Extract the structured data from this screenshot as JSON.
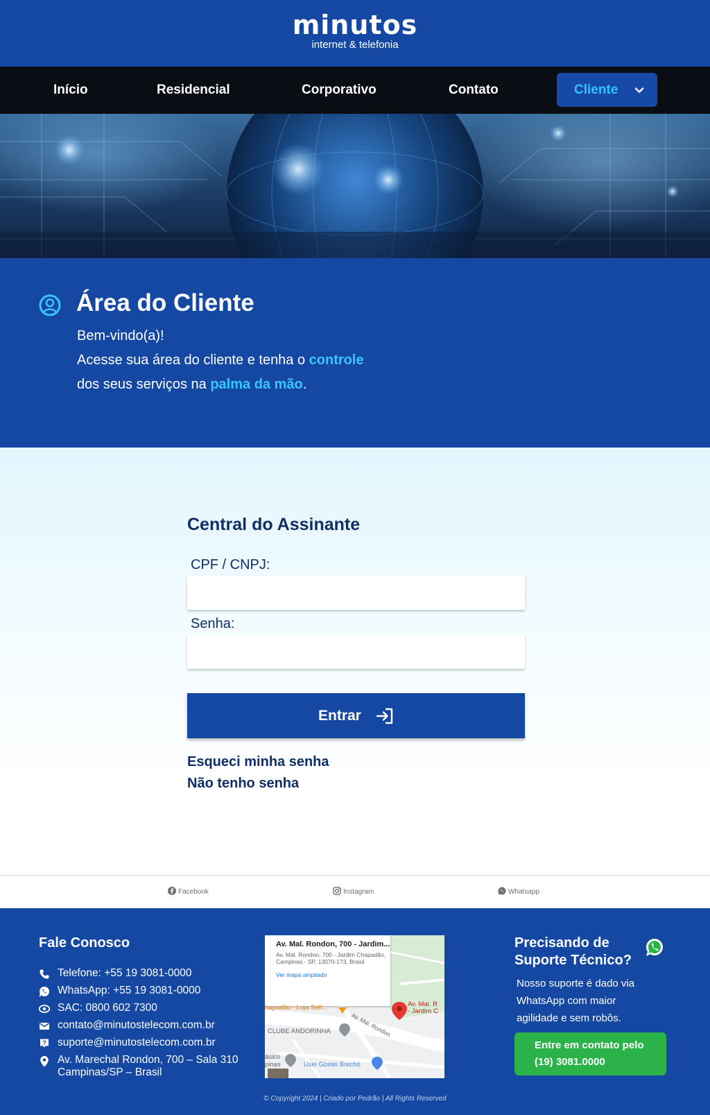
{
  "header": {
    "logo_word": "minutos",
    "logo_tagline": "internet & telefonia"
  },
  "nav": {
    "items": [
      {
        "label": "Início"
      },
      {
        "label": "Residencial"
      },
      {
        "label": "Corporativo"
      },
      {
        "label": "Contato"
      }
    ],
    "cliente_label": "Cliente"
  },
  "area": {
    "title": "Área do Cliente",
    "line1": "Bem-vindo(a)!",
    "line2_prefix": "Acesse sua área do cliente e tenha o ",
    "line2_highlight": "controle",
    "line3_prefix": "dos seus serviços na ",
    "line3_highlight": "palma da mão",
    "line3_suffix": "."
  },
  "login": {
    "title": "Central do Assinante",
    "cpf_label": "CPF / CNPJ:",
    "cpf_value": "",
    "senha_label": "Senha:",
    "senha_value": "",
    "submit_label": "Entrar",
    "forgot_link": "Esqueci minha senha",
    "no_password_link": "Não tenho senha"
  },
  "social": {
    "facebook": "Facebook",
    "instagram": "Instagram",
    "whatsapp": "Whatsapp"
  },
  "footer": {
    "contact_title": "Fale Conosco",
    "contacts": [
      {
        "icon": "phone-icon",
        "text": "Telefone: +55 19 3081-0000"
      },
      {
        "icon": "whatsapp-icon",
        "text": "WhatsApp: +55 19 3081-0000"
      },
      {
        "icon": "sac-icon",
        "text": "SAC: 0800 602 7300"
      },
      {
        "icon": "email-icon",
        "text": "contato@minutostelecom.com.br"
      },
      {
        "icon": "support-icon",
        "text": "suporte@minutostelecom.com.br"
      },
      {
        "icon": "location-pin-icon",
        "text": "Av. Marechal Rondon, 700 – Sala 310",
        "text2": "Campinas/SP – Brasil"
      }
    ],
    "map": {
      "card_title": "Av. Mal. Rondon, 700 - Jardim...",
      "card_address": "Av. Mal. Rondon, 700 - Jardim Chapadão, Campinas - SP, 13070-173, Brasil",
      "card_link": "Ver mapa ampliado",
      "label_loja": "hapadão - Loja Self...",
      "label_street": "Av. Mal. Rondon",
      "label_pin_1": "Av. Mal. R",
      "label_pin_2": "- Jardim C",
      "label_clube": "CLUBE ANDORINHA",
      "label_asico_1": "ásico",
      "label_asico_2": "pinas",
      "label_usei": "Usei Gostei Brechó"
    },
    "support_title_1": "Precisando de",
    "support_title_2": "Suporte Técnico?",
    "support_text_1": "Nosso suporte é dado via",
    "support_text_2": "WhatsApp com maior",
    "support_text_3": "agilidade e sem robôs.",
    "support_button_1": "Entre em contato pelo",
    "support_button_2": "(19) 3081.0000",
    "copyright": "© Copyright 2024 | Criado por Pedrão | All Rights Reserved"
  },
  "colors": {
    "primary_blue": "#1448a3",
    "accent_cyan": "#37c7ff",
    "dark_navy_text": "#0f2f66",
    "whatsapp_green": "#2bb34a"
  }
}
